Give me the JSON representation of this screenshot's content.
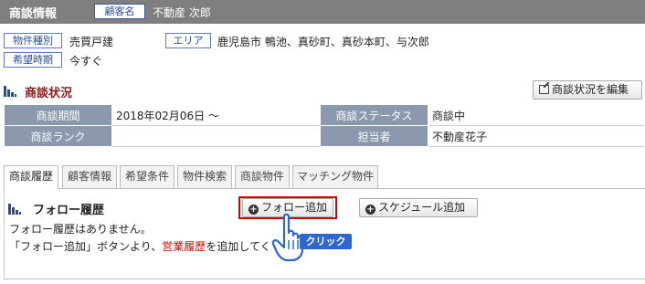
{
  "header": {
    "title": "商談情報",
    "customer_tag": "顧客名",
    "customer_name": "不動産 次郎"
  },
  "summary": {
    "property_type_label": "物件種別",
    "property_type_value": "売買戸建",
    "area_label": "エリア",
    "area_value": "鹿児島市 鴨池、真砂町、真砂本町、与次郎",
    "timing_label": "希望時期",
    "timing_value": "今すぐ"
  },
  "status_section": {
    "title": "商談状況",
    "edit_button": "商談状況を編集",
    "rows": [
      {
        "label1": "商談期間",
        "value1": "2018年02月06日 ～",
        "label2": "商談ステータス",
        "value2": "商談中"
      },
      {
        "label1": "商談ランク",
        "value1": "",
        "label2": "担当者",
        "value2": "不動産花子"
      }
    ]
  },
  "tabs": [
    "商談履歴",
    "顧客情報",
    "希望条件",
    "物件検索",
    "商談物件",
    "マッチング物件"
  ],
  "follow_section": {
    "title": "フォロー履歴",
    "add_follow_button": "フォロー追加",
    "add_schedule_button": "スケジュール追加",
    "empty_message": "フォロー履歴はありません。",
    "hint_prefix": "「フォロー追加」ボタンより、",
    "hint_highlight": "営業履歴",
    "hint_suffix": "を追加してく",
    "hint_tail": "。"
  },
  "annotation": {
    "click_label": "クリック"
  },
  "colors": {
    "header_bg": "#7f7f7f",
    "label_bg": "#8b98ad",
    "section_title": "#8b1a1a",
    "highlight_red": "#d40000",
    "click_blue": "#2f66c9"
  }
}
